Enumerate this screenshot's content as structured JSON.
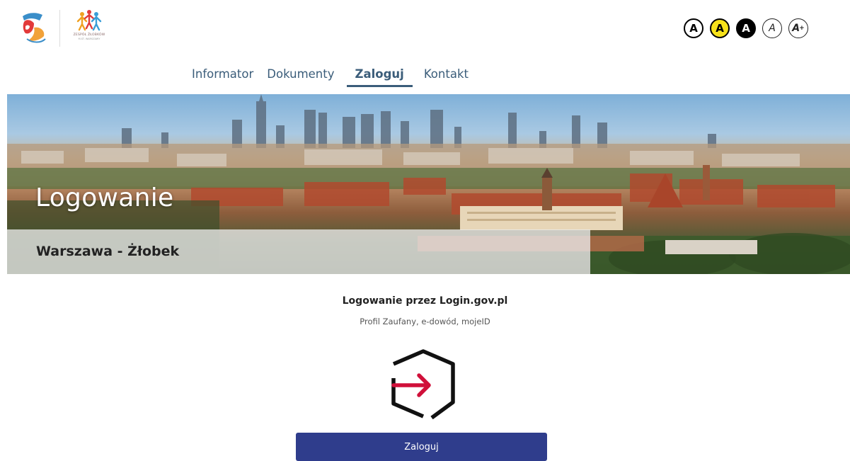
{
  "header": {
    "logo_right_text": "ZESPÓŁ ŻŁOBKÓW",
    "logo_right_sub": "M.ST. WARSZAWY",
    "contrast_buttons": [
      {
        "label": "A"
      },
      {
        "label": "A"
      },
      {
        "label": "A"
      },
      {
        "label": "A"
      },
      {
        "label": "A",
        "suffix": "+"
      }
    ]
  },
  "nav": {
    "items": [
      {
        "label": "Informator"
      },
      {
        "label": "Dokumenty"
      },
      {
        "label": "Zaloguj",
        "active": true
      },
      {
        "label": "Kontakt"
      }
    ]
  },
  "banner": {
    "title": "Logowanie",
    "subtitle": "Warszawa - Żłobek"
  },
  "login": {
    "title": "Logowanie przez Login.gov.pl",
    "description": "Profil Zaufany, e-dowód, mojeID",
    "button_label": "Zaloguj"
  },
  "colors": {
    "accent_nav": "#3b5d7a",
    "button_bg": "#2f3d8c",
    "highlight_yellow": "#f7e21b",
    "arrow_red": "#d0103a"
  }
}
